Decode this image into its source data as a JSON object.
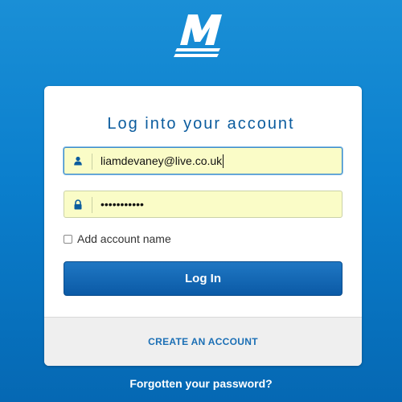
{
  "logo": {
    "icon": "m-logo-icon"
  },
  "login_card": {
    "title": "Log into your account",
    "email_field": {
      "value": "liamdevaney@live.co.uk",
      "icon": "user-icon"
    },
    "password_field": {
      "masked_value": "•••••••••••",
      "icon": "lock-icon"
    },
    "add_account_name": {
      "label": "Add account name",
      "checked": false
    },
    "login_button": {
      "label": "Log In"
    },
    "create_account_link": "CREATE AN ACCOUNT"
  },
  "forgot_password_link": "Forgotten your password?",
  "colors": {
    "background": "#0b7fcd",
    "primary": "#0b5aa6",
    "field_fill": "#fafcc7",
    "title": "#0b5c9e"
  }
}
